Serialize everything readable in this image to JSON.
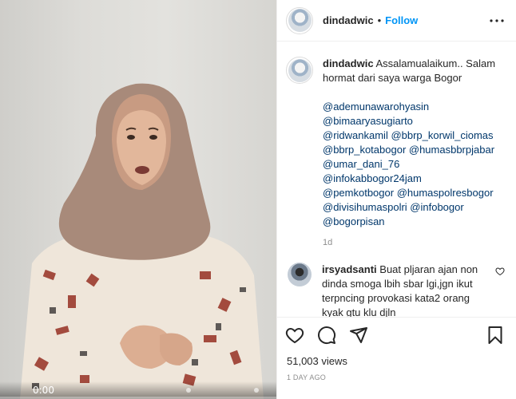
{
  "video": {
    "time": "0:00",
    "progress": 0.0
  },
  "header": {
    "username": "dindadwic",
    "separator": "•",
    "follow_label": "Follow"
  },
  "caption": {
    "username": "dindadwic",
    "text": "Assalamualaikum.. Salam hormat dari saya warga Bogor",
    "mentions": [
      "@ademunawarohyasin",
      "@bimaaryasugiarto",
      "@ridwankamil @bbrp_korwil_ciomas",
      "@bbrp_kotabogor @humasbbrpjabar",
      "@umar_dani_76",
      "@infokabbogor24jam",
      "@pemkotbogor @humaspolresbogor",
      "@divisihumaspolri @infobogor",
      "@bogorpisan"
    ],
    "time": "1d"
  },
  "comments": [
    {
      "username": "irsyadsanti",
      "text": "Buat pljaran ajan non dinda smoga lbih sbar lgi,jgn ikut terpncing provokasi kata2 orang kyak gtu klu djln"
    }
  ],
  "actions": {
    "views": "51,003 views",
    "posted": "1 DAY AGO"
  },
  "icons": {
    "more": "more-horizontal-icon",
    "like": "heart-icon",
    "comment": "comment-bubble-icon",
    "share": "paper-plane-icon",
    "save": "bookmark-icon"
  },
  "colors": {
    "follow": "#0095f6",
    "mention": "#00376b",
    "muted": "#8e8e8e"
  }
}
